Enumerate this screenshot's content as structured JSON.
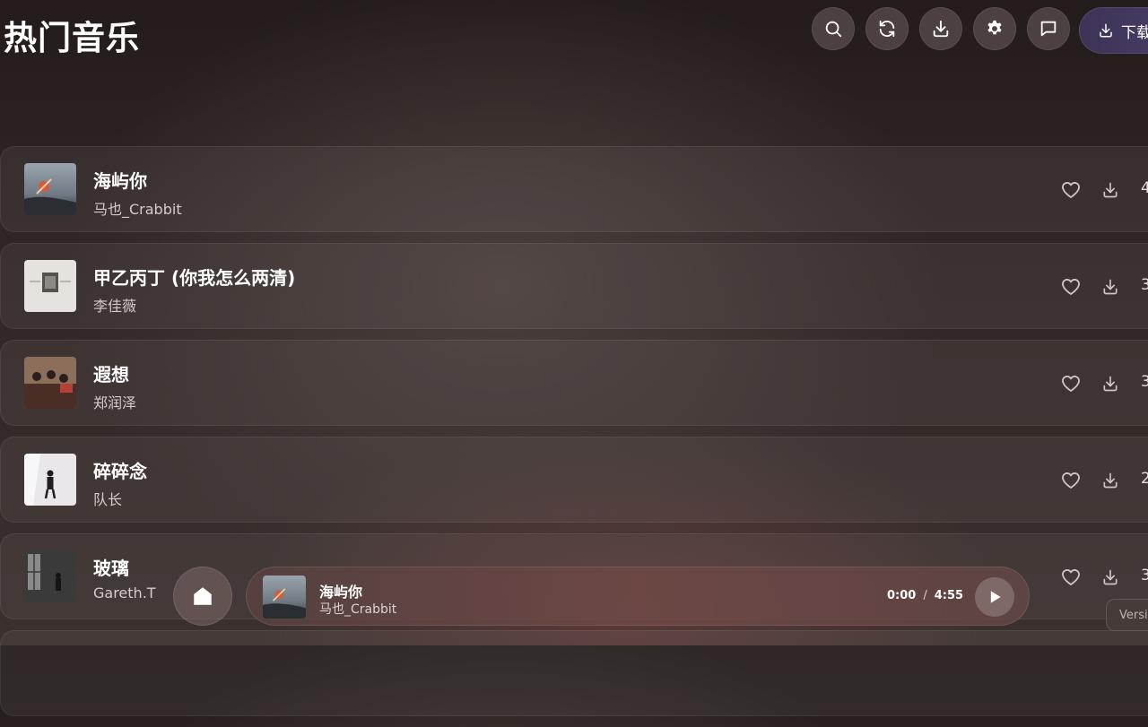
{
  "header": {
    "title": "热门音乐",
    "icons": [
      "search-icon",
      "refresh-icon",
      "download-icon",
      "gear-icon",
      "chat-icon"
    ],
    "download_button": "下载"
  },
  "songs": [
    {
      "title": "海屿你",
      "artist": "马也_Crabbit",
      "duration": "4"
    },
    {
      "title": "甲乙丙丁 (你我怎么两清)",
      "artist": "李佳薇",
      "duration": "3"
    },
    {
      "title": "遐想",
      "artist": "郑润泽",
      "duration": "3"
    },
    {
      "title": "碎碎念",
      "artist": "队长",
      "duration": "2"
    },
    {
      "title": "玻璃",
      "artist": "Gareth.T",
      "duration": "3"
    }
  ],
  "player": {
    "title": "海屿你",
    "artist": "马也_Crabbit",
    "current_time": "0:00",
    "separator": "/",
    "total_time": "4:55"
  },
  "version_label": "Versi",
  "colors": {
    "accent": "#3e3356",
    "background": "#2e2524"
  }
}
